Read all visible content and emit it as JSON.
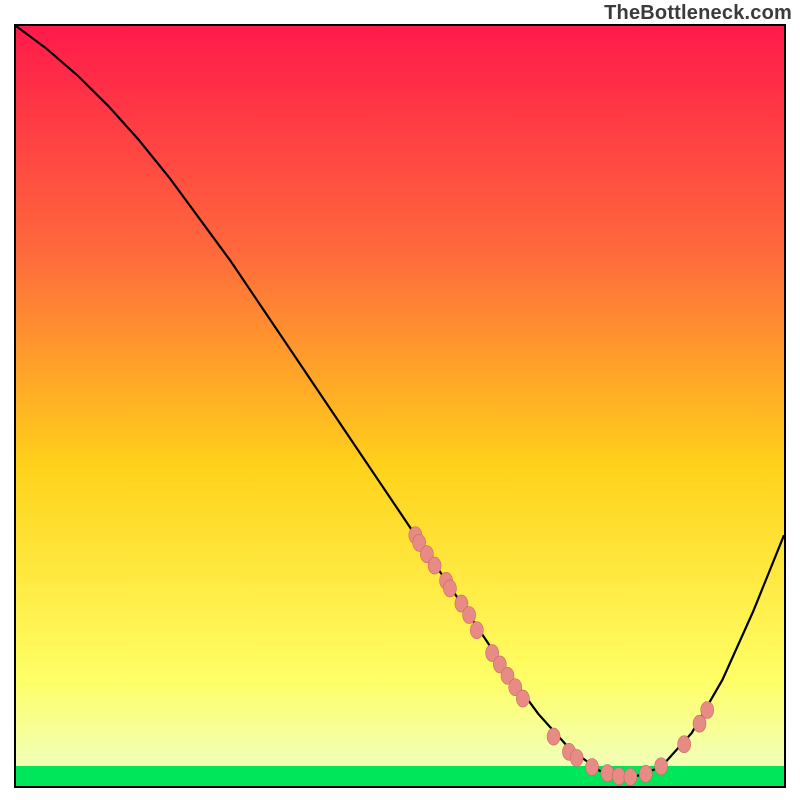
{
  "watermark": "TheBottleneck.com",
  "chart_data": {
    "type": "line",
    "title": "",
    "xlabel": "",
    "ylabel": "",
    "xlim": [
      0,
      100
    ],
    "ylim": [
      0,
      100
    ],
    "curve": {
      "name": "bottleneck-curve",
      "x": [
        0,
        4,
        8,
        12,
        16,
        20,
        24,
        28,
        32,
        36,
        40,
        44,
        48,
        52,
        56,
        60,
        64,
        68,
        72,
        76,
        80,
        84,
        88,
        92,
        96,
        100
      ],
      "y": [
        100,
        97,
        93.5,
        89.5,
        85,
        80,
        74.5,
        69,
        63,
        57,
        51,
        45,
        39,
        33,
        27,
        21,
        15,
        9.5,
        5,
        2,
        1,
        2.5,
        7,
        14,
        23,
        33
      ]
    },
    "scatter": {
      "name": "sample-points",
      "points": [
        {
          "x": 52,
          "y": 33
        },
        {
          "x": 52.5,
          "y": 32
        },
        {
          "x": 53.5,
          "y": 30.5
        },
        {
          "x": 54.5,
          "y": 29
        },
        {
          "x": 56,
          "y": 27
        },
        {
          "x": 56.5,
          "y": 26
        },
        {
          "x": 58,
          "y": 24
        },
        {
          "x": 59,
          "y": 22.5
        },
        {
          "x": 60,
          "y": 20.5
        },
        {
          "x": 62,
          "y": 17.5
        },
        {
          "x": 63,
          "y": 16
        },
        {
          "x": 64,
          "y": 14.5
        },
        {
          "x": 65,
          "y": 13
        },
        {
          "x": 66,
          "y": 11.5
        },
        {
          "x": 70,
          "y": 6.5
        },
        {
          "x": 72,
          "y": 4.5
        },
        {
          "x": 73,
          "y": 3.7
        },
        {
          "x": 75,
          "y": 2.5
        },
        {
          "x": 77,
          "y": 1.7
        },
        {
          "x": 78.5,
          "y": 1.3
        },
        {
          "x": 80,
          "y": 1.2
        },
        {
          "x": 82,
          "y": 1.6
        },
        {
          "x": 84,
          "y": 2.6
        },
        {
          "x": 87,
          "y": 5.5
        },
        {
          "x": 89,
          "y": 8.2
        },
        {
          "x": 90,
          "y": 10
        }
      ]
    },
    "colors": {
      "gradient_top": "#ff1a4a",
      "gradient_mid1": "#ff6a3c",
      "gradient_mid2": "#ffd21a",
      "gradient_mid3": "#ffff66",
      "gradient_bottom_band": "#00e65a",
      "curve": "#000000",
      "point_fill": "#e78b84",
      "point_stroke": "#c96a63",
      "frame": "#000000"
    }
  }
}
